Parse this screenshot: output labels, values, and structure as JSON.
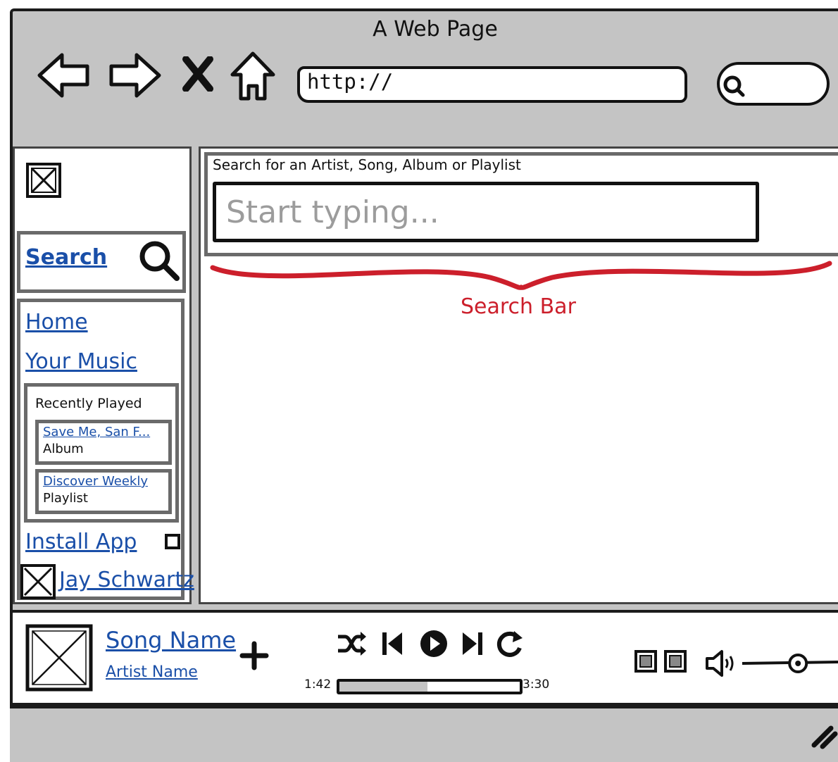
{
  "browser": {
    "title": "A Web Page",
    "url": "http://"
  },
  "sidebar": {
    "search_label": "Search",
    "nav": [
      {
        "label": "Home"
      },
      {
        "label": "Your Music"
      }
    ],
    "recently_played": {
      "heading": "Recently Played",
      "items": [
        {
          "title": "Save Me, San F...",
          "type": "Album"
        },
        {
          "title": "Discover Weekly",
          "type": "Playlist"
        }
      ]
    },
    "install_label": "Install App",
    "user_name": "Jay Schwartz"
  },
  "main": {
    "search_caption": "Search for an Artist, Song, Album or Playlist",
    "search_placeholder": "Start typing...",
    "annotation": "Search Bar",
    "annotation_color": "#cc1f2b"
  },
  "player": {
    "song_name": "Song Name",
    "artist_name": "Artist Name",
    "elapsed": "1:42",
    "duration": "3:30",
    "progress_fraction": 0.49,
    "volume_fraction": 0.6,
    "controls": [
      "shuffle-icon",
      "previous-icon",
      "play-icon",
      "next-icon",
      "repeat-icon"
    ]
  },
  "colors": {
    "chrome": "#c4c4c4",
    "link": "#1a4fa8",
    "panel_border": "#6a6a6a"
  }
}
